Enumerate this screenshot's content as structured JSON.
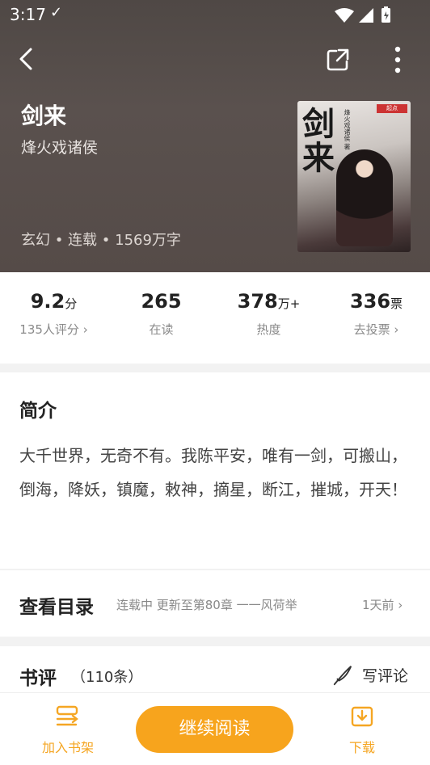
{
  "status_bar": {
    "time": "3:17",
    "check": "✓"
  },
  "book": {
    "title": "剑来",
    "author": "烽火戏诸侯",
    "meta": "玄幻 • 连载 • 1569万字",
    "cover": {
      "title": "剑来",
      "small_text": "烽火戏诸侯 著",
      "badge": "起点"
    }
  },
  "stats": [
    {
      "value": "9.2",
      "unit": "分",
      "label": "135人评分 ›"
    },
    {
      "value": "265",
      "unit": "",
      "label": "在读"
    },
    {
      "value": "378",
      "unit": "万+",
      "label": "热度"
    },
    {
      "value": "336",
      "unit": "票",
      "label": "去投票 ›"
    }
  ],
  "intro": {
    "heading": "简介",
    "text": "大千世界，无奇不有。我陈平安，唯有一剑，可搬山，倒海，降妖，镇魔，敕神，摘星，断江，摧城，开天！"
  },
  "toc": {
    "heading": "查看目录",
    "status": "连载中 更新至第80章 一一风荷举",
    "time": "1天前 ›"
  },
  "reviews": {
    "heading": "书评",
    "count": "（110条）",
    "write_label": "写评论"
  },
  "bottom": {
    "add_shelf": "加入书架",
    "continue": "继续阅读",
    "download": "下载"
  },
  "colors": {
    "accent": "#f7a41d",
    "hero_bg": "#554b48"
  },
  "icons": {
    "back": "back-arrow-icon",
    "share": "share-icon",
    "more": "more-vertical-icon"
  }
}
